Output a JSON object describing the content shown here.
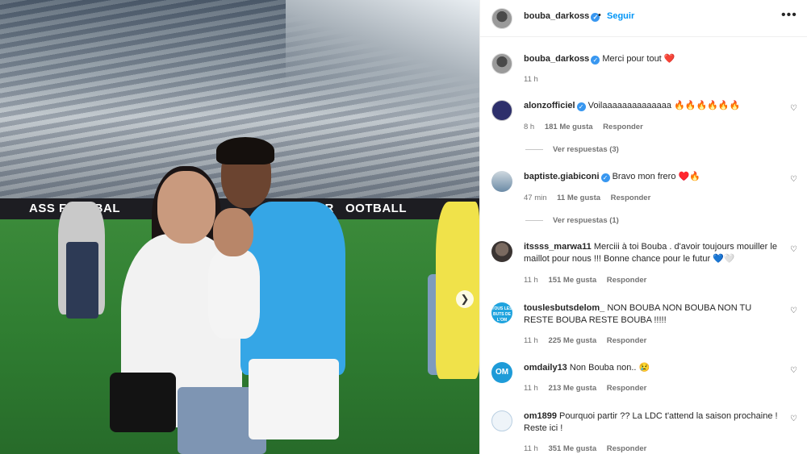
{
  "post": {
    "author": "bouba_darkoss",
    "follow_label": "Seguir",
    "dot": "•",
    "more_label": "•••",
    "next_icon": "chevron-right-icon",
    "photo_boards": [
      "ASS FOOTBAL",
      "ER",
      "OOTBALL"
    ]
  },
  "caption": {
    "username": "bouba_darkoss",
    "text": "Merci pour tout ❤️",
    "time": "11 h"
  },
  "comments": [
    {
      "username": "alonzofficiel",
      "verified": true,
      "text": "Voilaaaaaaaaaaaaaa 🔥🔥🔥🔥🔥🔥",
      "time": "8 h",
      "likes": "181 Me gusta",
      "reply": "Responder",
      "view_replies": "Ver respuestas (3)"
    },
    {
      "username": "baptiste.giabiconi",
      "verified": true,
      "text": "Bravo mon frero ♥️🔥",
      "time": "47 min",
      "likes": "11 Me gusta",
      "reply": "Responder",
      "view_replies": "Ver respuestas (1)"
    },
    {
      "username": "itssss_marwa11",
      "verified": false,
      "text": "Merciii à toi Bouba . d'avoir toujours mouiller le maillot pour nous !!! Bonne chance pour le futur 💙🤍",
      "time": "11 h",
      "likes": "151 Me gusta",
      "reply": "Responder"
    },
    {
      "username": "touslesbutsdelom_",
      "verified": false,
      "text": "NON BOUBA NON BOUBA NON TU RESTE BOUBA RESTE BOUBA !!!!!",
      "time": "11 h",
      "likes": "225 Me gusta",
      "reply": "Responder",
      "avatar_text": "TOUS LES BUTS DE L'OM"
    },
    {
      "username": "omdaily13",
      "verified": false,
      "text": "Non Bouba non.. 😢",
      "time": "11 h",
      "likes": "213 Me gusta",
      "reply": "Responder",
      "avatar_text": "OM"
    },
    {
      "username": "om1899",
      "verified": false,
      "text": "Pourquoi partir ?? La LDC t'attend la saison prochaine ! Reste ici !",
      "time": "11 h",
      "likes": "351 Me gusta",
      "reply": "Responder"
    }
  ],
  "icons": {
    "verified": "✓",
    "heart_outline": "♡"
  }
}
